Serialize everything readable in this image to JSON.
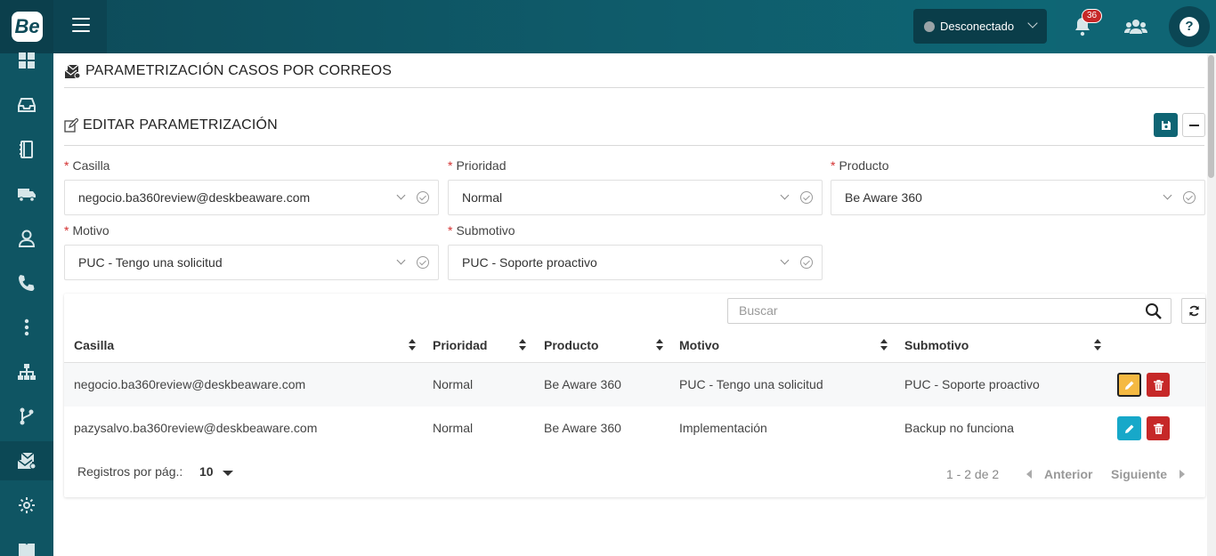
{
  "app": {
    "logo_text": "Be"
  },
  "header": {
    "status_label": "Desconectado",
    "notifications_count": "36",
    "help_label": "?"
  },
  "sidebar": {
    "items": [
      {
        "icon": "dashboard-icon"
      },
      {
        "icon": "inbox-icon"
      },
      {
        "icon": "notebook-icon"
      },
      {
        "icon": "truck-icon"
      },
      {
        "icon": "user-icon"
      },
      {
        "icon": "phone-icon"
      },
      {
        "icon": "more-vertical-icon"
      },
      {
        "icon": "sitemap-icon"
      },
      {
        "icon": "branch-icon"
      },
      {
        "icon": "mail-settings-icon",
        "active": true
      },
      {
        "icon": "gear-icon"
      },
      {
        "icon": "book-icon"
      }
    ]
  },
  "page": {
    "title": "PARAMETRIZACIÓN CASOS POR CORREOS",
    "section_title": "EDITAR PARAMETRIZACIÓN"
  },
  "form": {
    "casilla": {
      "label": "Casilla",
      "value": "negocio.ba360review@deskbeaware.com"
    },
    "prioridad": {
      "label": "Prioridad",
      "value": "Normal"
    },
    "producto": {
      "label": "Producto",
      "value": "Be Aware 360"
    },
    "motivo": {
      "label": "Motivo",
      "value": "PUC - Tengo una solicitud"
    },
    "submotivo": {
      "label": "Submotivo",
      "value": "PUC - Soporte proactivo"
    }
  },
  "table": {
    "search_placeholder": "Buscar",
    "columns": [
      "Casilla",
      "Prioridad",
      "Producto",
      "Motivo",
      "Submotivo"
    ],
    "rows": [
      [
        "negocio.ba360review@deskbeaware.com",
        "Normal",
        "Be Aware 360",
        "PUC - Tengo una solicitud",
        "PUC - Soporte proactivo"
      ],
      [
        "pazysalvo.ba360review@deskbeaware.com",
        "Normal",
        "Be Aware 360",
        "Implementación",
        "Backup no funciona"
      ]
    ],
    "per_page_label": "Registros por pág.:",
    "per_page_value": "10",
    "page_info": "1 - 2 de 2",
    "prev_label": "Anterior",
    "next_label": "Siguiente"
  },
  "colors": {
    "brand": "#0f5b6a",
    "edit_selected": "#f5b942",
    "edit": "#17a8c9",
    "delete": "#c62828",
    "required": "#d32f2f"
  }
}
